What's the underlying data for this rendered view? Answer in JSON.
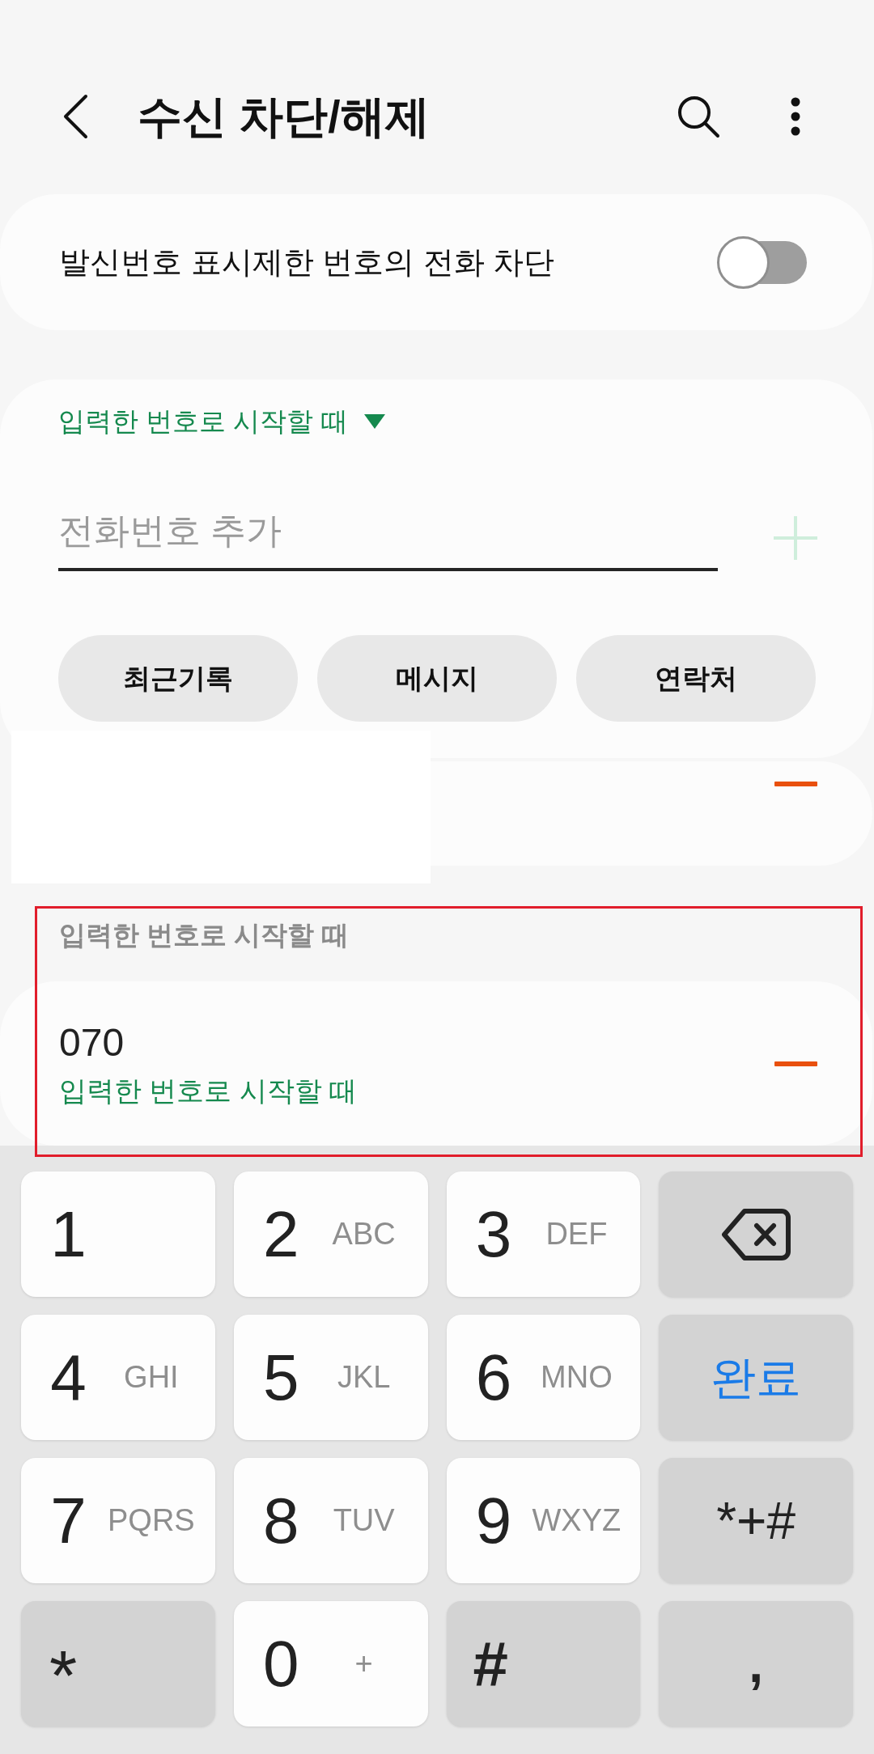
{
  "header": {
    "title": "수신 차단/해제"
  },
  "private_number_block": {
    "label": "발신번호 표시제한 번호의 전화 차단",
    "on": false
  },
  "add_number": {
    "match_mode": "입력한 번호로 시작할 때",
    "placeholder": "전화번호 추가",
    "add_button": {
      "disabled": true
    },
    "sources": [
      "최근기록",
      "메시지",
      "연락처"
    ]
  },
  "blocked_list": [
    {
      "kind": "entry",
      "redacted": true,
      "highlighted": false
    },
    {
      "kind": "header",
      "label": "입력한 번호로 시작할 때",
      "highlighted": true
    },
    {
      "kind": "entry",
      "redacted": false,
      "number": "070",
      "match_mode": "입력한 번호로 시작할 때",
      "highlighted": true
    }
  ],
  "keypad": {
    "keys": [
      {
        "kind": "digit",
        "label": "1"
      },
      {
        "kind": "digit",
        "label": "2",
        "letters": "ABC"
      },
      {
        "kind": "digit",
        "label": "3",
        "letters": "DEF"
      },
      {
        "kind": "backspace"
      },
      {
        "kind": "digit",
        "label": "4",
        "letters": "GHI"
      },
      {
        "kind": "digit",
        "label": "5",
        "letters": "JKL"
      },
      {
        "kind": "digit",
        "label": "6",
        "letters": "MNO"
      },
      {
        "kind": "done",
        "label": "완료"
      },
      {
        "kind": "digit",
        "label": "7",
        "letters": "PQRS"
      },
      {
        "kind": "digit",
        "label": "8",
        "letters": "TUV"
      },
      {
        "kind": "digit",
        "label": "9",
        "letters": "WXYZ"
      },
      {
        "kind": "symbols",
        "label": "*+#"
      },
      {
        "kind": "star",
        "label": "*"
      },
      {
        "kind": "digit",
        "label": "0",
        "letters": "+"
      },
      {
        "kind": "hash",
        "label": "#"
      },
      {
        "kind": "comma",
        "label": ","
      }
    ]
  }
}
